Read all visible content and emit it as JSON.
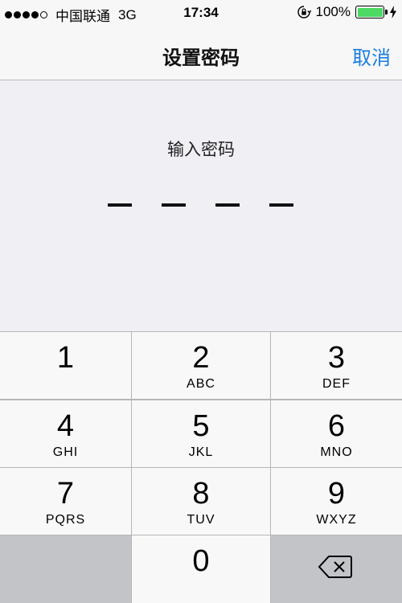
{
  "status_bar": {
    "signal_bars": 4,
    "signal_total": 5,
    "carrier": "中国联通",
    "network": "3G",
    "time": "17:34",
    "battery_percent": "100%",
    "battery_level": 1.0,
    "battery_color": "#4cd964",
    "icons": [
      "orientation-lock-icon",
      "battery-icon",
      "charging-bolt-icon"
    ]
  },
  "nav": {
    "title": "设置密码",
    "cancel_label": "取消",
    "accent_color": "#1a7ee0"
  },
  "passcode": {
    "prompt": "输入密码",
    "digits_total": 4,
    "digits_entered": 0
  },
  "keypad": {
    "keys": [
      {
        "digit": "1",
        "letters": ""
      },
      {
        "digit": "2",
        "letters": "ABC"
      },
      {
        "digit": "3",
        "letters": "DEF"
      },
      {
        "digit": "4",
        "letters": "GHI"
      },
      {
        "digit": "5",
        "letters": "JKL"
      },
      {
        "digit": "6",
        "letters": "MNO"
      },
      {
        "digit": "7",
        "letters": "PQRS"
      },
      {
        "digit": "8",
        "letters": "TUV"
      },
      {
        "digit": "9",
        "letters": "WXYZ"
      },
      {
        "digit": "0",
        "letters": ""
      }
    ],
    "delete_icon": "delete-backspace-icon"
  }
}
